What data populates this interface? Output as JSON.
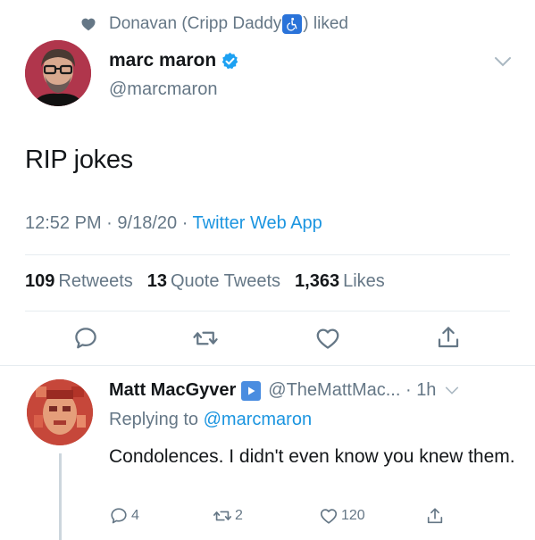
{
  "social_context": {
    "liked_by_prefix": "Donavan (Cripp Daddy",
    "liked_by_suffix": ") liked"
  },
  "tweet": {
    "author_name": "marc maron",
    "author_handle": "@marcmaron",
    "text": "RIP jokes",
    "time": "12:52 PM",
    "date": "9/18/20",
    "source": "Twitter Web App",
    "stats": {
      "retweets_count": "109",
      "retweets_label": "Retweets",
      "quotes_count": "13",
      "quotes_label": "Quote Tweets",
      "likes_count": "1,363",
      "likes_label": "Likes"
    }
  },
  "reply": {
    "author_name": "Matt MacGyver",
    "author_handle": "@TheMattMac...",
    "time": "1h",
    "replying_prefix": "Replying to",
    "replying_to": "@marcmaron",
    "text": "Condolences. I didn't even know you knew them.",
    "reply_count": "4",
    "retweet_count": "2",
    "like_count": "120"
  },
  "colors": {
    "link": "#1b95e0",
    "muted": "#657786",
    "verified": "#1da1f2"
  }
}
